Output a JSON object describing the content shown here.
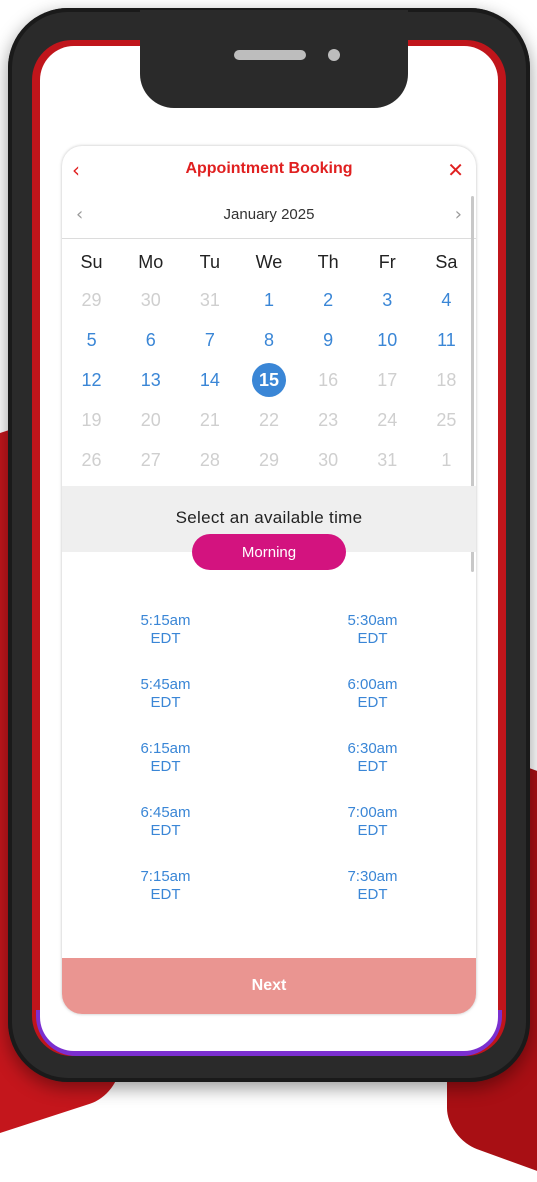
{
  "header": {
    "title": "Appointment Booking",
    "back_icon": "‹",
    "close_icon": "✕"
  },
  "calendar": {
    "month_label": "January 2025",
    "prev_icon": "‹",
    "next_icon": "›",
    "weekdays": [
      "Su",
      "Mo",
      "Tu",
      "We",
      "Th",
      "Fr",
      "Sa"
    ],
    "days": [
      {
        "label": "29",
        "state": "muted"
      },
      {
        "label": "30",
        "state": "muted"
      },
      {
        "label": "31",
        "state": "muted"
      },
      {
        "label": "1",
        "state": "avail"
      },
      {
        "label": "2",
        "state": "avail"
      },
      {
        "label": "3",
        "state": "avail"
      },
      {
        "label": "4",
        "state": "avail"
      },
      {
        "label": "5",
        "state": "avail"
      },
      {
        "label": "6",
        "state": "avail"
      },
      {
        "label": "7",
        "state": "avail"
      },
      {
        "label": "8",
        "state": "avail"
      },
      {
        "label": "9",
        "state": "avail"
      },
      {
        "label": "10",
        "state": "avail"
      },
      {
        "label": "11",
        "state": "avail"
      },
      {
        "label": "12",
        "state": "avail"
      },
      {
        "label": "13",
        "state": "avail"
      },
      {
        "label": "14",
        "state": "avail"
      },
      {
        "label": "15",
        "state": "selected"
      },
      {
        "label": "16",
        "state": "muted"
      },
      {
        "label": "17",
        "state": "muted"
      },
      {
        "label": "18",
        "state": "muted"
      },
      {
        "label": "19",
        "state": "muted"
      },
      {
        "label": "20",
        "state": "muted"
      },
      {
        "label": "21",
        "state": "muted"
      },
      {
        "label": "22",
        "state": "muted"
      },
      {
        "label": "23",
        "state": "muted"
      },
      {
        "label": "24",
        "state": "muted"
      },
      {
        "label": "25",
        "state": "muted"
      },
      {
        "label": "26",
        "state": "muted"
      },
      {
        "label": "27",
        "state": "muted"
      },
      {
        "label": "28",
        "state": "muted"
      },
      {
        "label": "29",
        "state": "muted"
      },
      {
        "label": "30",
        "state": "muted"
      },
      {
        "label": "31",
        "state": "muted"
      },
      {
        "label": "1",
        "state": "muted"
      }
    ]
  },
  "time_section": {
    "prompt": "Select an available time",
    "period": "Morning"
  },
  "slots": [
    {
      "time": "5:15am",
      "zone": "EDT"
    },
    {
      "time": "5:30am",
      "zone": "EDT"
    },
    {
      "time": "5:45am",
      "zone": "EDT"
    },
    {
      "time": "6:00am",
      "zone": "EDT"
    },
    {
      "time": "6:15am",
      "zone": "EDT"
    },
    {
      "time": "6:30am",
      "zone": "EDT"
    },
    {
      "time": "6:45am",
      "zone": "EDT"
    },
    {
      "time": "7:00am",
      "zone": "EDT"
    },
    {
      "time": "7:15am",
      "zone": "EDT"
    },
    {
      "time": "7:30am",
      "zone": "EDT"
    }
  ],
  "footer": {
    "next_label": "Next"
  },
  "colors": {
    "accent_red": "#e02020",
    "available_blue": "#3a86d6",
    "period_pink": "#d3137f",
    "next_button": "#ea9591"
  }
}
